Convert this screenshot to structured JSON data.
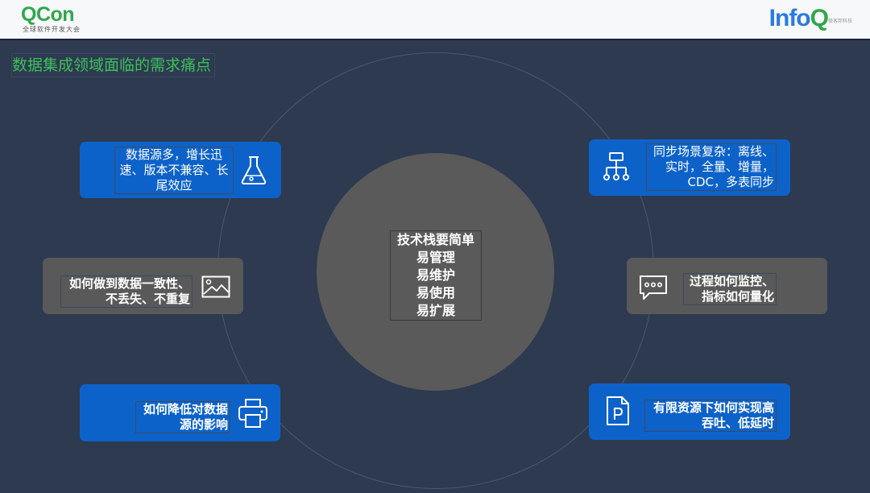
{
  "header": {
    "qcon_name": "QCon",
    "qcon_subtitle": "全球软件开发大会",
    "infoq_text": "Info",
    "infoq_q": "Q",
    "infoq_sup": "极客邦科技"
  },
  "slide": {
    "title": "数据集成领域面临的需求痛点",
    "center_lines": [
      "技术栈要简单",
      "易管理",
      "易维护",
      "易使用",
      "易扩展"
    ]
  },
  "cards": {
    "top_left": {
      "line1": "数据源多，增长迅",
      "line2": "速、版本不兼容、长",
      "line3": "尾效应",
      "icon": "flask-icon"
    },
    "mid_left": {
      "line1": "如何做到数据一致性、",
      "line2": "不丢失、不重复",
      "icon": "image-icon"
    },
    "bottom_left": {
      "line1": "如何降低对数据",
      "line2": "源的影响",
      "icon": "printer-icon"
    },
    "top_right": {
      "line1": "同步场景复杂：离线、",
      "line2": "实时，全量、增量，",
      "line3": "CDC，多表同步",
      "icon": "hierarchy-icon"
    },
    "mid_right": {
      "line1": "过程如何监控、",
      "line2": "指标如何量化",
      "icon": "chat-icon"
    },
    "bottom_right": {
      "line1": "有限资源下如何实现高",
      "line2": "吞吐、低延时",
      "icon": "document-p-icon"
    }
  },
  "colors": {
    "background": "#2d3a50",
    "card_blue": "#0d62c9",
    "card_gray": "#595959",
    "center_circle": "#5a5a5a",
    "title_green": "#3cc15a",
    "brand_green": "#2ea84b",
    "brand_blue": "#2a7be0"
  }
}
